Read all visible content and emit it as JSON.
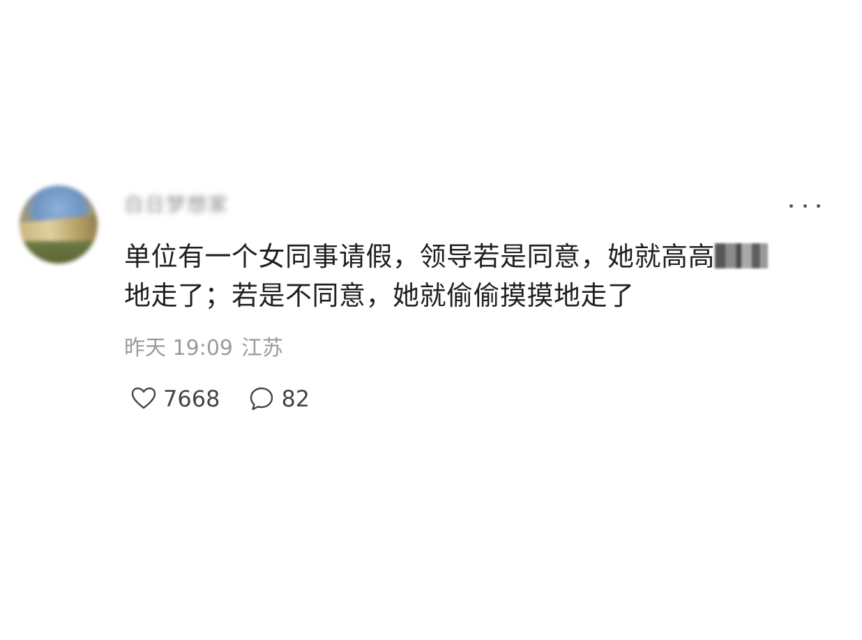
{
  "comment": {
    "username": "白日梦想家",
    "more_label": "more",
    "text": {
      "line1": "单位有一个女同事请假，领导若是同意，她就高高",
      "line1_censored": "兴兴",
      "line2": "地走了；若是不同意，她就偷偷摸摸地走了"
    },
    "meta": {
      "time": "昨天 19:09",
      "location": "江苏"
    },
    "actions": {
      "like_count": "7668",
      "like_icon": "heart-icon",
      "reply_count": "82",
      "reply_icon": "speech-bubble-icon"
    },
    "colors": {
      "text": "#1f1f1f",
      "meta": "#9a9a9a",
      "icon": "#444444"
    }
  }
}
